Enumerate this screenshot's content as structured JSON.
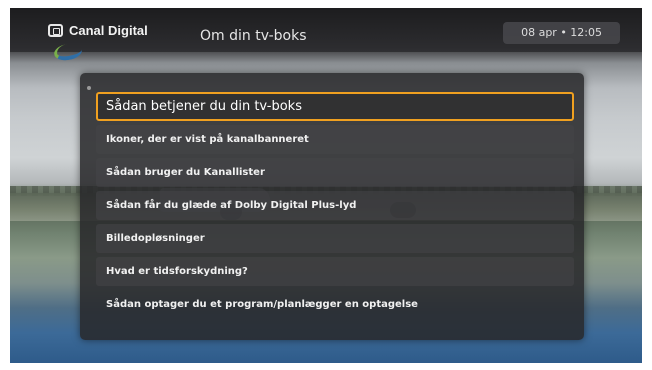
{
  "header": {
    "brand": "Canal Digital",
    "title": "Om din tv-boks",
    "datetime": "08 apr • 12:05"
  },
  "menu": {
    "items": [
      {
        "label": "Sådan betjener du din tv-boks",
        "selected": true
      },
      {
        "label": "Ikoner, der er vist på kanalbanneret"
      },
      {
        "label": "Sådan bruger du Kanallister"
      },
      {
        "label": "Sådan får du glæde af Dolby Digital Plus-lyd"
      },
      {
        "label": "Billedopløsninger"
      },
      {
        "label": "Hvad er tidsforskydning?"
      },
      {
        "label": "Sådan optager du et program/planlægger en optagelse"
      }
    ]
  },
  "colors": {
    "focus_border": "#f0a020",
    "panel": "#28282a"
  }
}
